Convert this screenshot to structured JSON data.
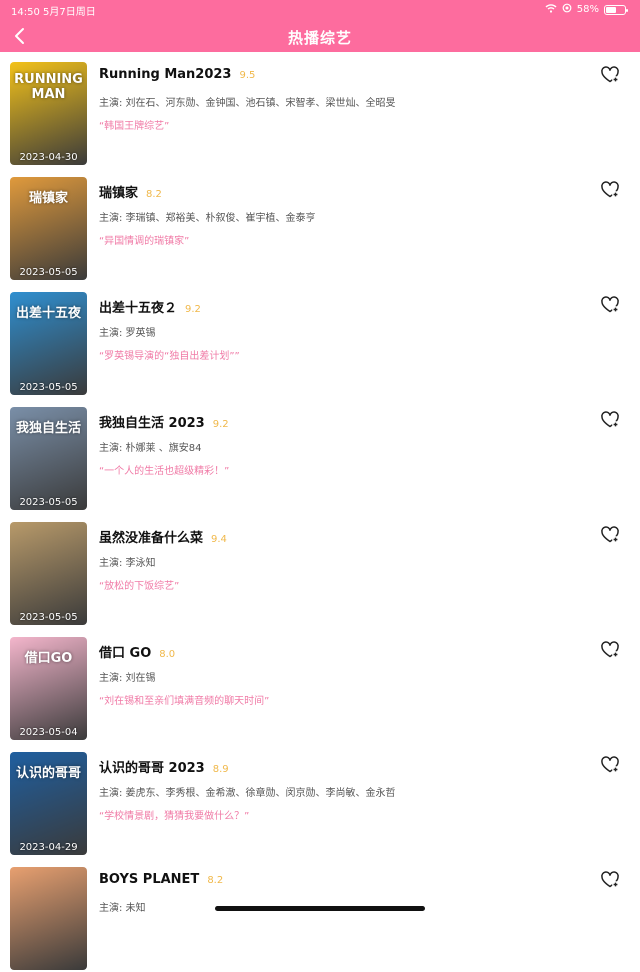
{
  "status_bar": {
    "time_date": "14:50  5月7日周日",
    "battery_pct": "58%",
    "battery_level": 0.58
  },
  "header": {
    "title": "热播综艺"
  },
  "items": [
    {
      "name": "Running Man2023",
      "score": "9.5",
      "cast": "主演: 刘在石、河东勋、金钟国、池石镇、宋智孝、梁世灿、全昭旻",
      "quote": "“韩国王牌综艺”",
      "date": "2023-04-30",
      "poster_text": "RUNNING MAN",
      "poster_color": "#f3c21a"
    },
    {
      "name": "瑞镇家",
      "score": "8.2",
      "cast": "主演: 李瑞镇、郑裕美、朴叙俊、崔宇植、金泰亨",
      "quote": "“异国情调的瑞镇家”",
      "date": "2023-05-05",
      "poster_text": "瑞镇家",
      "poster_color": "#e09a3c"
    },
    {
      "name": "出差十五夜２",
      "score": "9.2",
      "cast": "主演: 罗英锡",
      "quote": "“罗英锡导演的“独自出差计划””",
      "date": "2023-05-05",
      "poster_text": "出差十五夜",
      "poster_color": "#2f8fd0"
    },
    {
      "name": "我独自生活 2023",
      "score": "9.2",
      "cast": "主演: 朴娜莱 、旗安84",
      "quote": "“一个人的生活也超级精彩！”",
      "date": "2023-05-05",
      "poster_text": "我独自生活",
      "poster_color": "#7a8fa8"
    },
    {
      "name": "虽然没准备什么菜",
      "score": "9.4",
      "cast": "主演: 李泳知",
      "quote": "“放松的下饭综艺”",
      "date": "2023-05-05",
      "poster_text": "",
      "poster_color": "#b89a6a"
    },
    {
      "name": "借口 GO",
      "score": "8.0",
      "cast": "主演: 刘在锡",
      "quote": "“刘在锡和至亲们填满音频的聊天时间”",
      "date": "2023-05-04",
      "poster_text": "借口GO",
      "poster_color": "#f4b6cc"
    },
    {
      "name": "认识的哥哥 2023",
      "score": "8.9",
      "cast": "主演: 姜虎东、李秀根、金希澈、徐章勋、闵京勋、李尚敏、金永哲",
      "quote": "“学校情景剧，猜猜我要做什么？”",
      "date": "2023-04-29",
      "poster_text": "认识的哥哥",
      "poster_color": "#1f5fa0"
    },
    {
      "name": "BOYS PLANET",
      "score": "8.2",
      "cast": "主演: 未知",
      "quote": "",
      "date": "",
      "poster_text": "",
      "poster_color": "#e8a070"
    }
  ]
}
